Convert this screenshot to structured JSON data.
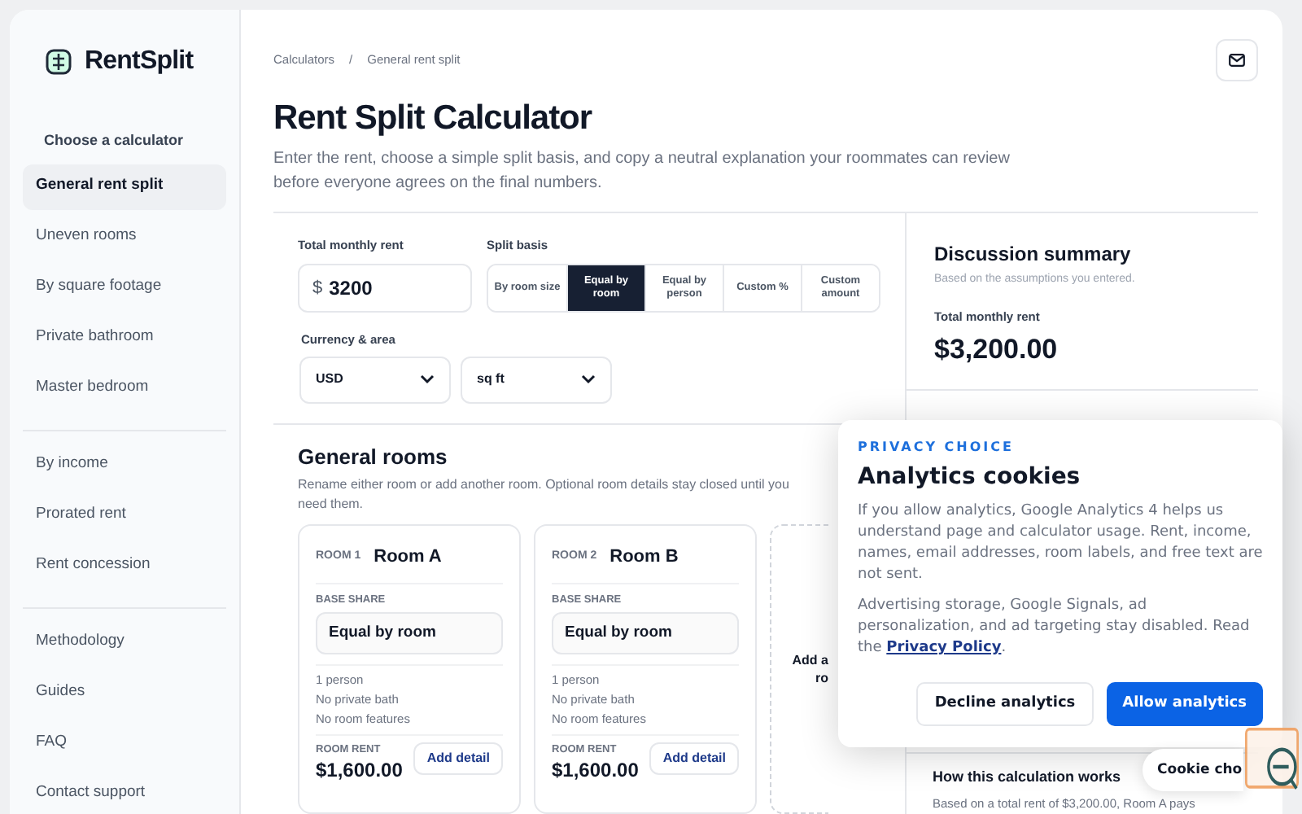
{
  "brand": {
    "name": "RentSplit"
  },
  "sidebar": {
    "heading": "Choose a calculator",
    "groups": [
      [
        {
          "label": "General rent split",
          "selected": true
        },
        {
          "label": "Uneven rooms",
          "selected": false
        },
        {
          "label": "By square footage",
          "selected": false
        },
        {
          "label": "Private bathroom",
          "selected": false
        },
        {
          "label": "Master bedroom",
          "selected": false
        }
      ],
      [
        {
          "label": "By income",
          "selected": false
        },
        {
          "label": "Prorated rent",
          "selected": false
        },
        {
          "label": "Rent concession",
          "selected": false
        }
      ],
      [
        {
          "label": "Methodology",
          "selected": false
        },
        {
          "label": "Guides",
          "selected": false
        },
        {
          "label": "FAQ",
          "selected": false
        },
        {
          "label": "Contact support",
          "selected": false
        }
      ]
    ]
  },
  "breadcrumb": [
    "Calculators",
    "/",
    "General rent split"
  ],
  "title": "Rent Split Calculator",
  "subtitle": "Enter the rent, choose a simple split basis, and copy a neutral explanation your roommates can review before everyone agrees on the final numbers.",
  "form": {
    "rent_label": "Total monthly rent",
    "currency_symbol": "$",
    "rent_value": "3200",
    "split_label": "Split basis",
    "split_options": [
      {
        "label": "By room size",
        "selected": false
      },
      {
        "label": "Equal by room",
        "selected": true
      },
      {
        "label": "Equal by person",
        "selected": false
      },
      {
        "label": "Custom %",
        "selected": false
      },
      {
        "label": "Custom amount",
        "selected": false
      }
    ],
    "area_label": "Currency & area",
    "currency": "USD",
    "unit": "sq ft"
  },
  "rooms_section": {
    "title": "General rooms",
    "description": "Rename either room or add another room. Optional room details stay closed until you need them.",
    "rooms": [
      {
        "number": "ROOM 1",
        "name": "Room A",
        "share_label": "BASE SHARE",
        "share": "Equal by room",
        "details": [
          "1 person",
          "No private bath",
          "No room features"
        ],
        "rent_label": "ROOM RENT",
        "rent": "$1,600.00",
        "button": "Add detail"
      },
      {
        "number": "ROOM 2",
        "name": "Room B",
        "share_label": "BASE SHARE",
        "share": "Equal by room",
        "details": [
          "1 person",
          "No private bath",
          "No room features"
        ],
        "rent_label": "ROOM RENT",
        "rent": "$1,600.00",
        "button": "Add detail"
      }
    ],
    "add_room": [
      "Add a",
      "ro"
    ]
  },
  "summary": {
    "title": "Discussion summary",
    "note": "Based on the assumptions you entered.",
    "total_label": "Total monthly rent",
    "total": "$3,200.00",
    "how_title": "How this calculation works",
    "how_text": "Based on a total rent of $3,200.00, Room A pays"
  },
  "cookie_dialog": {
    "eyebrow": "PRIVACY CHOICE",
    "title": "Analytics cookies",
    "text1": "If you allow analytics, Google Analytics 4 helps us understand page and calculator usage. Rent, income, names, email addresses, room labels, and free text are not sent.",
    "text2_before": "Advertising storage, Google Signals, ad personalization, and ad targeting stay disabled. Read the",
    "link": "Privacy Policy",
    "text2_after": ".",
    "decline": "Decline analytics",
    "allow": "Allow analytics"
  },
  "cookie_choices_button": "Cookie cho"
}
